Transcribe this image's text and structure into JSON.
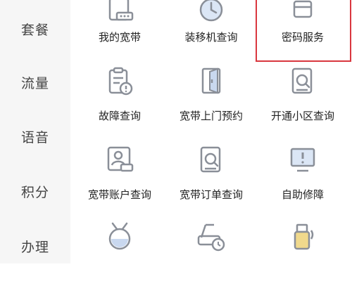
{
  "sidebar": {
    "items": [
      {
        "label": "套餐"
      },
      {
        "label": "流量"
      },
      {
        "label": "语音"
      },
      {
        "label": "积分"
      },
      {
        "label": "办理"
      }
    ]
  },
  "services": {
    "row1": [
      {
        "label": "我的宽带",
        "icon": "router-icon"
      },
      {
        "label": "装移机查询",
        "icon": "clock-icon"
      },
      {
        "label": "密码服务",
        "icon": "window-icon",
        "highlighted": true
      }
    ],
    "row2": [
      {
        "label": "故障查询",
        "icon": "clipboard-alert-icon"
      },
      {
        "label": "宽带上门预约",
        "icon": "door-icon"
      },
      {
        "label": "开通小区查询",
        "icon": "document-search-icon"
      }
    ],
    "row3": [
      {
        "label": "宽带账户查询",
        "icon": "account-card-icon"
      },
      {
        "label": "宽带订单查询",
        "icon": "order-search-icon"
      },
      {
        "label": "自助修障",
        "icon": "monitor-alert-icon"
      }
    ],
    "row4": [
      {
        "label": "",
        "icon": "tv-antenna-icon"
      },
      {
        "label": "",
        "icon": "router-clock-icon"
      },
      {
        "label": "",
        "icon": "usb-wireless-icon"
      }
    ]
  },
  "colors": {
    "icon_stroke": "#8a8f98",
    "icon_accent": "#f0d98c",
    "icon_fill": "#c9d8ef",
    "highlight_border": "#d9363e",
    "sidebar_bg": "#f6f6f6"
  }
}
